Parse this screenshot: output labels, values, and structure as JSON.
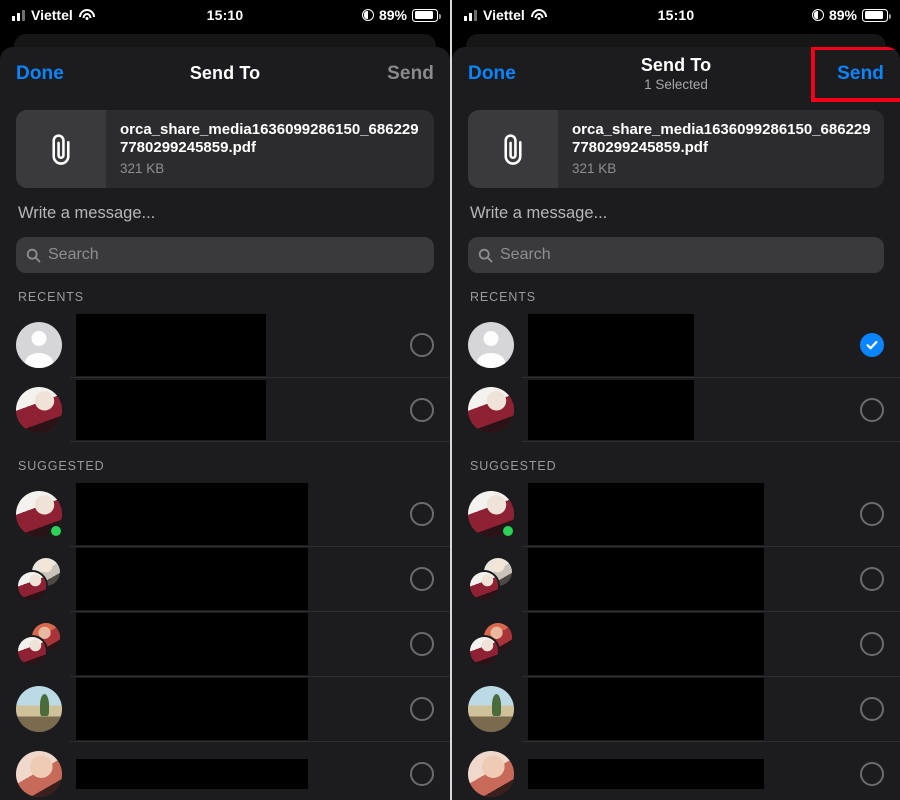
{
  "status_bar": {
    "carrier": "Viettel",
    "time": "15:10",
    "battery_percent": "89%",
    "wifi_icon": "wifi-icon",
    "signal_icon": "signal-bars-icon",
    "location_icon": "location-arrow-icon",
    "battery_icon": "battery-icon"
  },
  "colors": {
    "accent_blue": "#0a84ff",
    "disabled_gray": "#8a8a8e",
    "highlight_red": "#f4001a",
    "online_green": "#2ed158",
    "sheet_bg": "#1c1c1e",
    "card_bg": "#2c2c2e",
    "field_bg": "#3a3a3c"
  },
  "left_panel": {
    "header": {
      "done_label": "Done",
      "title": "Send To",
      "subtitle": "",
      "send_label": "Send",
      "send_enabled": false,
      "send_highlighted": false
    },
    "attachment": {
      "icon": "paperclip-icon",
      "filename": "orca_share_media1636099286150_6862297780299245859.pdf",
      "size": "321 KB"
    },
    "message_input": {
      "placeholder": "Write a message..."
    },
    "search": {
      "placeholder": "Search",
      "icon": "search-icon"
    },
    "sections": [
      {
        "title": "RECENTS",
        "rows": [
          {
            "avatar": "generic-person",
            "name_redacted": true,
            "redact_width": 190,
            "redact_height": 62,
            "online": false,
            "selected": false
          },
          {
            "avatar": "photo-a",
            "name_redacted": true,
            "redact_width": 190,
            "redact_height": 60,
            "online": false,
            "selected": false
          }
        ]
      },
      {
        "title": "SUGGESTED",
        "rows": [
          {
            "avatar": "group-a",
            "name_redacted": true,
            "redact_width": 232,
            "redact_height": 62,
            "online": true,
            "selected": false
          },
          {
            "avatar": "group-b",
            "name_redacted": true,
            "redact_width": 232,
            "redact_height": 62,
            "online": false,
            "selected": false
          },
          {
            "avatar": "group-c",
            "name_redacted": true,
            "redact_width": 232,
            "redact_height": 62,
            "online": false,
            "selected": false
          },
          {
            "avatar": "photo-d",
            "name_redacted": true,
            "redact_width": 232,
            "redact_height": 62,
            "online": false,
            "selected": false
          },
          {
            "avatar": "photo-e",
            "name_redacted": true,
            "redact_width": 232,
            "redact_height": 30,
            "online": false,
            "selected": false,
            "partial": true
          }
        ]
      }
    ]
  },
  "right_panel": {
    "header": {
      "done_label": "Done",
      "title": "Send To",
      "subtitle": "1 Selected",
      "send_label": "Send",
      "send_enabled": true,
      "send_highlighted": true
    },
    "attachment": {
      "icon": "paperclip-icon",
      "filename": "orca_share_media1636099286150_6862297780299245859.pdf",
      "size": "321 KB"
    },
    "message_input": {
      "placeholder": "Write a message..."
    },
    "search": {
      "placeholder": "Search",
      "icon": "search-icon"
    },
    "sections": [
      {
        "title": "RECENTS",
        "rows": [
          {
            "avatar": "generic-person",
            "name_redacted": true,
            "redact_width": 166,
            "redact_height": 62,
            "online": false,
            "selected": true
          },
          {
            "avatar": "photo-a",
            "name_redacted": true,
            "redact_width": 166,
            "redact_height": 60,
            "online": false,
            "selected": false
          }
        ]
      },
      {
        "title": "SUGGESTED",
        "rows": [
          {
            "avatar": "group-a",
            "name_redacted": true,
            "redact_width": 236,
            "redact_height": 62,
            "online": true,
            "selected": false
          },
          {
            "avatar": "group-b",
            "name_redacted": true,
            "redact_width": 236,
            "redact_height": 62,
            "online": false,
            "selected": false
          },
          {
            "avatar": "group-c",
            "name_redacted": true,
            "redact_width": 236,
            "redact_height": 62,
            "online": false,
            "selected": false
          },
          {
            "avatar": "photo-d",
            "name_redacted": true,
            "redact_width": 236,
            "redact_height": 62,
            "online": false,
            "selected": false
          },
          {
            "avatar": "photo-e",
            "name_redacted": true,
            "redact_width": 236,
            "redact_height": 30,
            "online": false,
            "selected": false,
            "partial": true
          }
        ]
      }
    ]
  }
}
